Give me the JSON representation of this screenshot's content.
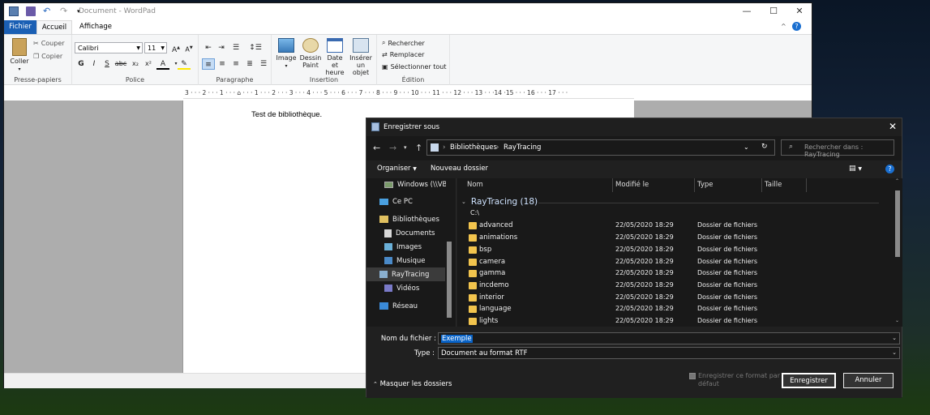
{
  "wordpad": {
    "title": "Document - WordPad",
    "tabs": {
      "fichier": "Fichier",
      "accueil": "Accueil",
      "affichage": "Affichage"
    },
    "clipboard": {
      "paste": "Coller",
      "cut": "Couper",
      "copy": "Copier",
      "group": "Presse-papiers"
    },
    "font": {
      "family": "Calibri",
      "size": "11",
      "group": "Police",
      "bold": "G",
      "italic": "I",
      "underline": "S"
    },
    "paragraph": {
      "group": "Paragraphe"
    },
    "insert": {
      "image": "Image",
      "paint_1": "Dessin",
      "paint_2": "Paint",
      "date_1": "Date et",
      "date_2": "heure",
      "object_1": "Insérer",
      "object_2": "un objet",
      "group": "Insertion"
    },
    "edit": {
      "find": "Rechercher",
      "replace": "Remplacer",
      "select_all": "Sélectionner tout",
      "group": "Édition"
    },
    "ruler": "3 · · · 2 · · · 1 · · · ⌂ · · · 1 · · · 2 · · · 3 · · · 4 · · · 5 · · · 6 · · · 7 · · · 8 · · · 9 · · · 10 · · · 11 · · · 12 · · · 13 · · ·14 ·15 · · · 16 · · · 17 · · ·",
    "doc_text": "Test de bibliothèque."
  },
  "dialog": {
    "title": "Enregistrer sous",
    "path": [
      "Bibliothèques",
      "RayTracing"
    ],
    "search_placeholder": "Rechercher dans : RayTracing",
    "organize": "Organiser",
    "new_folder": "Nouveau dossier",
    "nav_items": [
      {
        "label": "Windows (\\\\VBo"
      },
      {
        "label": "Ce PC"
      },
      {
        "label": "Bibliothèques"
      },
      {
        "label": "Documents"
      },
      {
        "label": "Images"
      },
      {
        "label": "Musique"
      },
      {
        "label": "RayTracing"
      },
      {
        "label": "Vidéos"
      },
      {
        "label": "Réseau"
      }
    ],
    "columns": {
      "name": "Nom",
      "modified": "Modifié le",
      "type": "Type",
      "size": "Taille"
    },
    "group_header": "RayTracing (18)",
    "group_path": "C:\\",
    "files": [
      {
        "name": "advanced",
        "date": "22/05/2020 18:29",
        "type": "Dossier de fichiers"
      },
      {
        "name": "animations",
        "date": "22/05/2020 18:29",
        "type": "Dossier de fichiers"
      },
      {
        "name": "bsp",
        "date": "22/05/2020 18:29",
        "type": "Dossier de fichiers"
      },
      {
        "name": "camera",
        "date": "22/05/2020 18:29",
        "type": "Dossier de fichiers"
      },
      {
        "name": "gamma",
        "date": "22/05/2020 18:29",
        "type": "Dossier de fichiers"
      },
      {
        "name": "incdemo",
        "date": "22/05/2020 18:29",
        "type": "Dossier de fichiers"
      },
      {
        "name": "interior",
        "date": "22/05/2020 18:29",
        "type": "Dossier de fichiers"
      },
      {
        "name": "language",
        "date": "22/05/2020 18:29",
        "type": "Dossier de fichiers"
      },
      {
        "name": "lights",
        "date": "22/05/2020 18:29",
        "type": "Dossier de fichiers"
      }
    ],
    "filename_label": "Nom du fichier :",
    "filename_value": "Exemple",
    "type_label": "Type :",
    "type_value": "Document au format RTF",
    "hide_folders": "Masquer les dossiers",
    "save_ext_checkbox": "Enregistrer ce format par défaut",
    "save_button": "Enregistrer",
    "cancel_button": "Annuler"
  }
}
